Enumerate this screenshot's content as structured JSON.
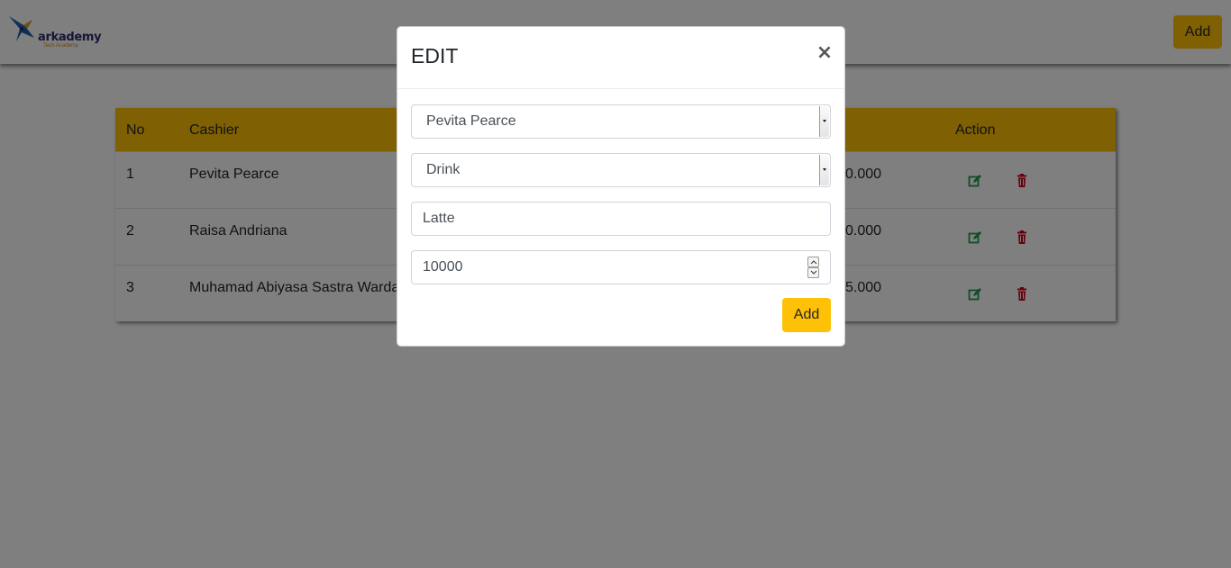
{
  "brand": {
    "name": "arkademy",
    "tagline": "Tech Academy"
  },
  "navbar": {
    "add_label": "Add"
  },
  "table": {
    "headers": [
      "No",
      "Cashier",
      "Action"
    ],
    "rows": [
      {
        "no": "1",
        "cashier": "Pevita Pearce",
        "price_fragment": "0.000"
      },
      {
        "no": "2",
        "cashier": "Raisa Andriana",
        "price_fragment": "0.000"
      },
      {
        "no": "3",
        "cashier": "Muhamad Abiyasa Sastra Warda",
        "price_fragment": "5.000"
      }
    ]
  },
  "modal": {
    "title": "EDIT",
    "close_label": "×",
    "cashier_select": "Pevita Pearce",
    "category_select": "Drink",
    "name_input": "Latte",
    "price_input": "10000",
    "submit_label": "Add"
  },
  "colors": {
    "accent": "#ffc107",
    "edit_icon": "#1e9b4b",
    "delete_icon": "#d0021b",
    "backdrop": "rgba(0,0,0,0.5)"
  },
  "icons": {
    "edit": "pencil-square-icon",
    "delete": "trash-icon",
    "close": "close-icon"
  }
}
